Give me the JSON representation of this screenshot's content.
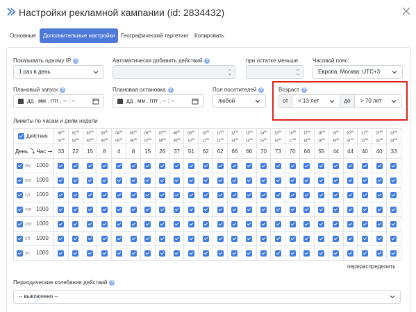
{
  "header": {
    "title": "Настройки рекламной кампании (id: 2834432)",
    "icon": "double-chevron-right-icon",
    "close_icon": "close-icon"
  },
  "tabs": [
    {
      "label": "Основные",
      "active": false
    },
    {
      "label": "Дополнительные настройки",
      "active": true
    },
    {
      "label": "Географический таргетинг",
      "active": false
    },
    {
      "label": "Копировать",
      "active": false
    }
  ],
  "form": {
    "show_one_ip": {
      "label": "Показывать одному IP",
      "value": "1 раз в день"
    },
    "auto_add": {
      "label": "Автоматически добавить действий",
      "value": ""
    },
    "when_less": {
      "label": "при остатке меньше",
      "value": ""
    },
    "timezone": {
      "label": "Часовой пояс:",
      "value": "Европа, Москва: UTC+3"
    },
    "planned_start": {
      "label": "Плановый запуск",
      "placeholder": "дд . мм . гггг ,  -- : --"
    },
    "planned_stop": {
      "label": "Плановая остановка",
      "placeholder": "дд . мм . гггг ,  -- : --"
    },
    "gender": {
      "label": "Пол посетителей",
      "value": "любой"
    },
    "age": {
      "label": "Возраст",
      "from_label": "от",
      "from_value": "< 13 лет",
      "to_label": "до",
      "to_value": "> 70 лет"
    }
  },
  "limits": {
    "title": "Лимиты по часам и дням недели",
    "actions_label": "Действия",
    "day_hour_label": "День ⤵ Час ➞",
    "hours": [
      {
        "from": "00",
        "to": "01"
      },
      {
        "from": "01",
        "to": "02"
      },
      {
        "from": "02",
        "to": "03"
      },
      {
        "from": "03",
        "to": "04"
      },
      {
        "from": "04",
        "to": "05"
      },
      {
        "from": "05",
        "to": "06"
      },
      {
        "from": "06",
        "to": "07"
      },
      {
        "from": "07",
        "to": "08"
      },
      {
        "from": "08",
        "to": "09"
      },
      {
        "from": "09",
        "to": "10"
      },
      {
        "from": "10",
        "to": "11"
      },
      {
        "from": "11",
        "to": "12"
      },
      {
        "from": "12",
        "to": "13"
      },
      {
        "from": "13",
        "to": "14"
      },
      {
        "from": "14",
        "to": "15"
      },
      {
        "from": "15",
        "to": "16"
      },
      {
        "from": "16",
        "to": "17"
      },
      {
        "from": "17",
        "to": "18"
      },
      {
        "from": "18",
        "to": "19"
      },
      {
        "from": "19",
        "to": "20"
      },
      {
        "from": "20",
        "to": "21"
      },
      {
        "from": "21",
        "to": "22"
      },
      {
        "from": "22",
        "to": "23"
      },
      {
        "from": "23",
        "to": "24"
      }
    ],
    "hour_sup": "00",
    "hourly_limits": [
      "33",
      "22",
      "15",
      "8",
      "4",
      "8",
      "15",
      "26",
      "37",
      "51",
      "62",
      "62",
      "66",
      "66",
      "70",
      "73",
      "70",
      "66",
      "55",
      "44",
      "44",
      "40",
      "40",
      "33"
    ],
    "days": [
      {
        "label": "пн",
        "limit": "1000"
      },
      {
        "label": "вт",
        "limit": "1000"
      },
      {
        "label": "ср",
        "limit": "1000"
      },
      {
        "label": "чт",
        "limit": "1000"
      },
      {
        "label": "пт",
        "limit": "1000"
      },
      {
        "label": "сб",
        "limit": "1000"
      },
      {
        "label": "вс",
        "limit": "1000"
      }
    ],
    "redistribute": "перераспределить"
  },
  "periodic": {
    "label": "Периодические колебания действий",
    "value": "-- выключено --"
  },
  "colors": {
    "accent": "#4e79d8",
    "checkbox": "#3f7be0",
    "highlight": "#e0201a"
  }
}
